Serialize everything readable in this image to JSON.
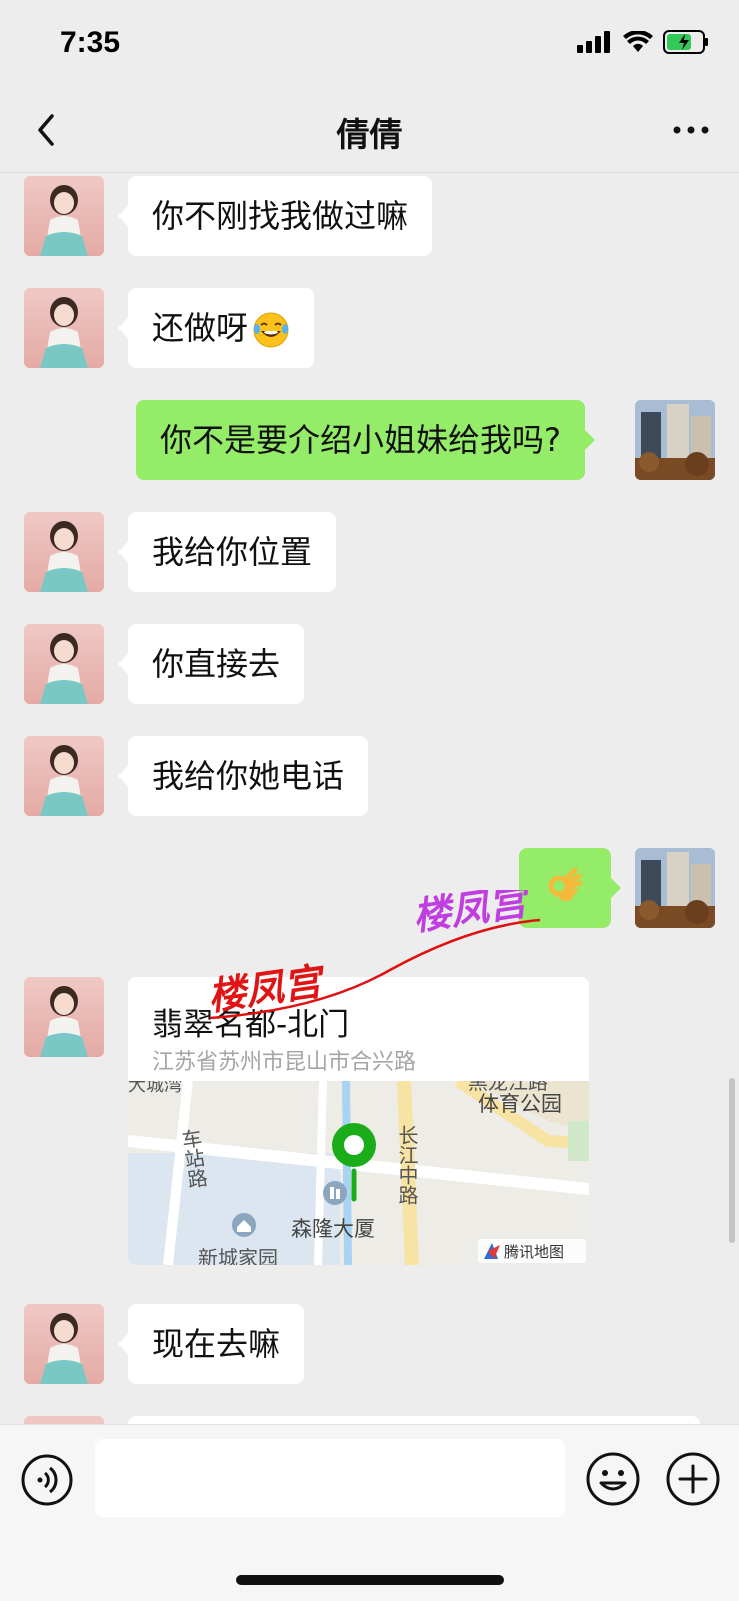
{
  "status": {
    "time": "7:35"
  },
  "header": {
    "title": "倩倩"
  },
  "messages": [
    {
      "side": "in",
      "text": "你不刚找我做过嘛"
    },
    {
      "side": "in",
      "text": "还做呀",
      "emoji": "laughing-tears-icon"
    },
    {
      "side": "me",
      "text": "你不是要介绍小姐妹给我吗?"
    },
    {
      "side": "in",
      "text": "我给你位置"
    },
    {
      "side": "in",
      "text": "你直接去"
    },
    {
      "side": "in",
      "text": "我给你她电话"
    },
    {
      "side": "me",
      "emoji": "ok-hand-icon"
    },
    {
      "side": "in",
      "type": "location"
    },
    {
      "side": "in",
      "text": "现在去嘛"
    }
  ],
  "location": {
    "title": "翡翠名都-北门",
    "address": "江苏省苏州市昆山市合兴路",
    "map_labels": {
      "road_1": "车站路",
      "road_2": "长江中路",
      "building": "森隆大厦",
      "park": "体育公园",
      "top_road": "黑龙江路",
      "top_left": "大城湾",
      "residential": "新城家园",
      "map_brand": "腾讯地图"
    }
  },
  "watermark": {
    "text1": "楼凤宫",
    "text2": "楼凤宫"
  },
  "colors": {
    "my_bubble": "#95ec69",
    "their_bubble": "#ffffff",
    "background": "#ededed",
    "pin": "#1aad19"
  }
}
